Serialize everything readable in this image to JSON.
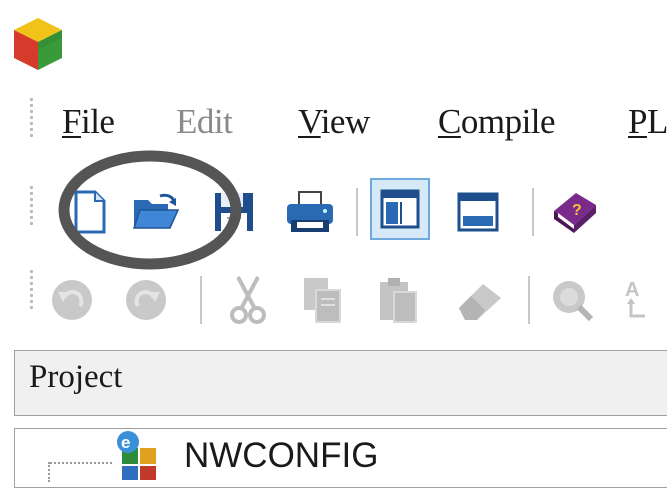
{
  "app": {
    "icon": "cube-app-icon"
  },
  "menu": {
    "items": [
      {
        "label": "File",
        "accel": "F",
        "rest": "ile",
        "enabled": true
      },
      {
        "label": "Edit",
        "accel": "",
        "rest": "Edit",
        "enabled": false
      },
      {
        "label": "View",
        "accel": "V",
        "rest": "iew",
        "enabled": true
      },
      {
        "label": "Compile",
        "accel": "C",
        "rest": "ompile",
        "enabled": true
      },
      {
        "label": "PL",
        "accel": "P",
        "rest": "L",
        "enabled": true
      }
    ]
  },
  "toolbar_main": {
    "buttons": [
      {
        "icon": "new-file-icon",
        "enabled": true,
        "pressed": false
      },
      {
        "icon": "open-folder-icon",
        "enabled": true,
        "pressed": false
      },
      {
        "icon": "save-icon",
        "enabled": true,
        "pressed": false
      },
      {
        "icon": "print-icon",
        "enabled": true,
        "pressed": false
      },
      {
        "icon": "project-view-icon",
        "enabled": true,
        "pressed": true
      },
      {
        "icon": "output-window-icon",
        "enabled": true,
        "pressed": false
      },
      {
        "icon": "help-book-icon",
        "enabled": true,
        "pressed": false
      }
    ]
  },
  "toolbar_edit": {
    "buttons": [
      {
        "icon": "undo-icon",
        "enabled": false
      },
      {
        "icon": "redo-icon",
        "enabled": false
      },
      {
        "icon": "cut-icon",
        "enabled": false
      },
      {
        "icon": "copy-icon",
        "enabled": false
      },
      {
        "icon": "paste-icon",
        "enabled": false
      },
      {
        "icon": "eraser-icon",
        "enabled": false
      },
      {
        "icon": "find-icon",
        "enabled": false
      },
      {
        "icon": "replace-icon",
        "enabled": false
      }
    ]
  },
  "annotation": {
    "shape": "ellipse",
    "color": "#555555"
  },
  "project_panel": {
    "title": "Project",
    "tree": [
      {
        "label": "NWCONFIG",
        "icon": "network-config-icon"
      }
    ]
  },
  "colors": {
    "accent": "#6fa8dc",
    "pressed_bg": "#d6e9f8",
    "disabled_text": "#8a8a8a"
  }
}
